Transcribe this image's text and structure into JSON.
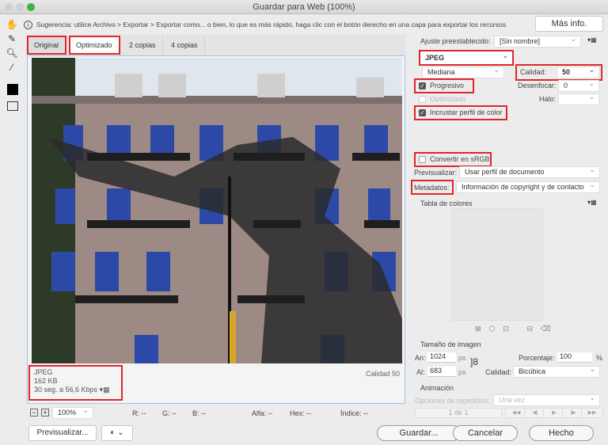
{
  "window": {
    "title": "Guardar para Web (100%)"
  },
  "hint": {
    "text": "Sugerencia: utilice Archivo > Exportar > Exportar como... o bien, lo que es más rápido, haga clic con el botón derecho en una capa para exportar los recursos",
    "more_info": "Más info."
  },
  "tabs": [
    "Original",
    "Optimizado",
    "2 copias",
    "4 copias"
  ],
  "preview": {
    "format": "JPEG",
    "size": "162 KB",
    "time": "30 seg. a 56,6 Kbps",
    "quality": "Calidad 50"
  },
  "status": {
    "zoom": "100%",
    "r": "R: --",
    "g": "G: --",
    "b": "B: --",
    "alpha": "Alfa: --",
    "hex": "Hex: --",
    "index": "Índice: --"
  },
  "settings": {
    "preset_label": "Ajuste preestablecido:",
    "preset": "[Sin nombre]",
    "format": "JPEG",
    "compression": "Mediana",
    "quality_label": "Calidad:",
    "quality": "50",
    "progressive": "Progresivo",
    "blur_label": "Desenfocar:",
    "blur": "0",
    "optimized": "Optimizado",
    "matte_label": "Halo:",
    "embed_profile": "Incrustar perfil de color",
    "convert_srgb": "Convertir en sRGB",
    "preview_label": "Previsualizar:",
    "preview": "Usar perfil de documento",
    "metadata_label": "Metadatos:",
    "metadata": "Información de copyright y de contacto",
    "color_table": "Tabla de colores"
  },
  "image_size": {
    "title": "Tamaño de imagen",
    "w_label": "An:",
    "w": "1024",
    "h_label": "Al:",
    "h": "683",
    "unit": "px",
    "percent_label": "Porcentaje:",
    "percent": "100",
    "percent_unit": "%",
    "quality_label": "Calidad:",
    "quality": "Bicúbica"
  },
  "animation": {
    "title": "Animación",
    "loop_label": "Opciones de repetición:",
    "loop": "Una vez",
    "frame": "1 de 1"
  },
  "buttons": {
    "preview": "Previsualizar...",
    "save": "Guardar...",
    "cancel": "Cancelar",
    "done": "Hecho"
  }
}
